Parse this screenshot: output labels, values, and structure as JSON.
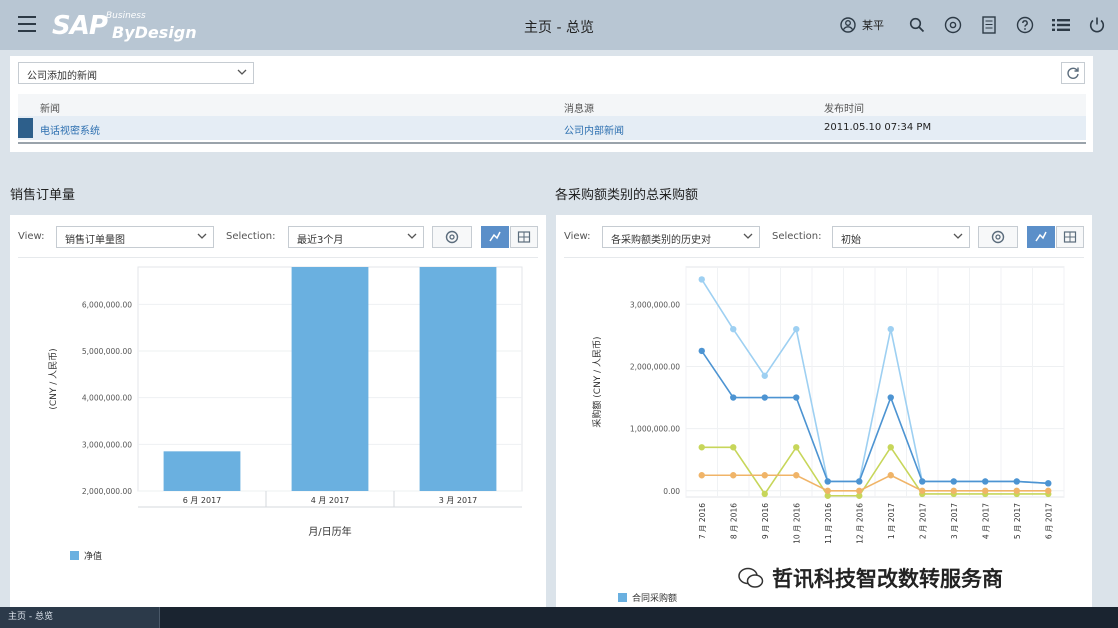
{
  "app": {
    "title": "主页 - 总览",
    "logo": {
      "brand": "SAP",
      "superscript": "Business",
      "product": "ByDesign"
    }
  },
  "user": {
    "name": "某平"
  },
  "news": {
    "filter_value": "公司添加的新闻",
    "columns": [
      "新闻",
      "消息源",
      "发布时间"
    ],
    "rows": [
      {
        "title": "电话视密系统",
        "source": "公司内部新闻",
        "time": "2011.05.10 07:34 PM"
      }
    ]
  },
  "left_panel": {
    "title": "销售订单量",
    "view_label": "View:",
    "view_value": "销售订单量图",
    "selection_label": "Selection:",
    "selection_value": "最近3个月",
    "legend": "净值"
  },
  "right_panel": {
    "title": "各采购额类别的总采购额",
    "view_label": "View:",
    "view_value": "各采购额类别的历史对",
    "selection_label": "Selection:",
    "selection_value": "初始",
    "legend": "合同采购额"
  },
  "taskbar": {
    "task": "主页 - 总览"
  },
  "watermark": "哲讯科技智改数转服务商",
  "colors": {
    "bar": "#6ab0e0",
    "accent": "#5b8fc9",
    "line1": "#9ed0f2",
    "line2": "#4d94d2",
    "line3": "#c7d65a",
    "line4": "#f0b468",
    "line5": "#b6d8f2"
  },
  "chart_data": [
    {
      "type": "bar",
      "categories": [
        "6 月 2017",
        "4 月 2017",
        "3 月 2017"
      ],
      "values": [
        2850000,
        6800000,
        6800000
      ],
      "ylabel": "(CNY / 人民币)",
      "xlabel": "月/日历年",
      "yticks": [
        "2,000,000.00",
        "3,000,000.00",
        "4,000,000.00",
        "5,000,000.00",
        "6,000,000.00"
      ],
      "ylim": [
        2000000,
        6800000
      ],
      "legend": [
        "净值"
      ]
    },
    {
      "type": "line",
      "categories": [
        "7 月 2016",
        "8 月 2016",
        "9 月 2016",
        "10 月 2016",
        "11 月 2016",
        "12 月 2016",
        "1 月 2017",
        "2 月 2017",
        "3 月 2017",
        "4 月 2017",
        "5 月 2017",
        "6 月 2017"
      ],
      "series": [
        {
          "values": [
            3400000,
            2600000,
            1850000,
            2600000,
            150000,
            150000,
            2600000,
            150000,
            150000,
            150000,
            150000,
            120000
          ]
        },
        {
          "values": [
            2250000,
            1500000,
            1500000,
            1500000,
            150000,
            150000,
            1500000,
            150000,
            150000,
            150000,
            150000,
            120000
          ]
        },
        {
          "values": [
            700000,
            700000,
            -50000,
            700000,
            -80000,
            -80000,
            700000,
            -50000,
            -50000,
            -50000,
            -50000,
            -50000
          ]
        },
        {
          "values": [
            250000,
            250000,
            250000,
            250000,
            0,
            0,
            250000,
            0,
            0,
            0,
            0,
            0
          ]
        }
      ],
      "ylabel": "采购额 (CNY / 人民币)",
      "yticks": [
        "0.00",
        "1,000,000.00",
        "2,000,000.00",
        "3,000,000.00"
      ],
      "ylim": [
        -100000,
        3600000
      ],
      "legend": [
        "合同采购额"
      ]
    }
  ]
}
